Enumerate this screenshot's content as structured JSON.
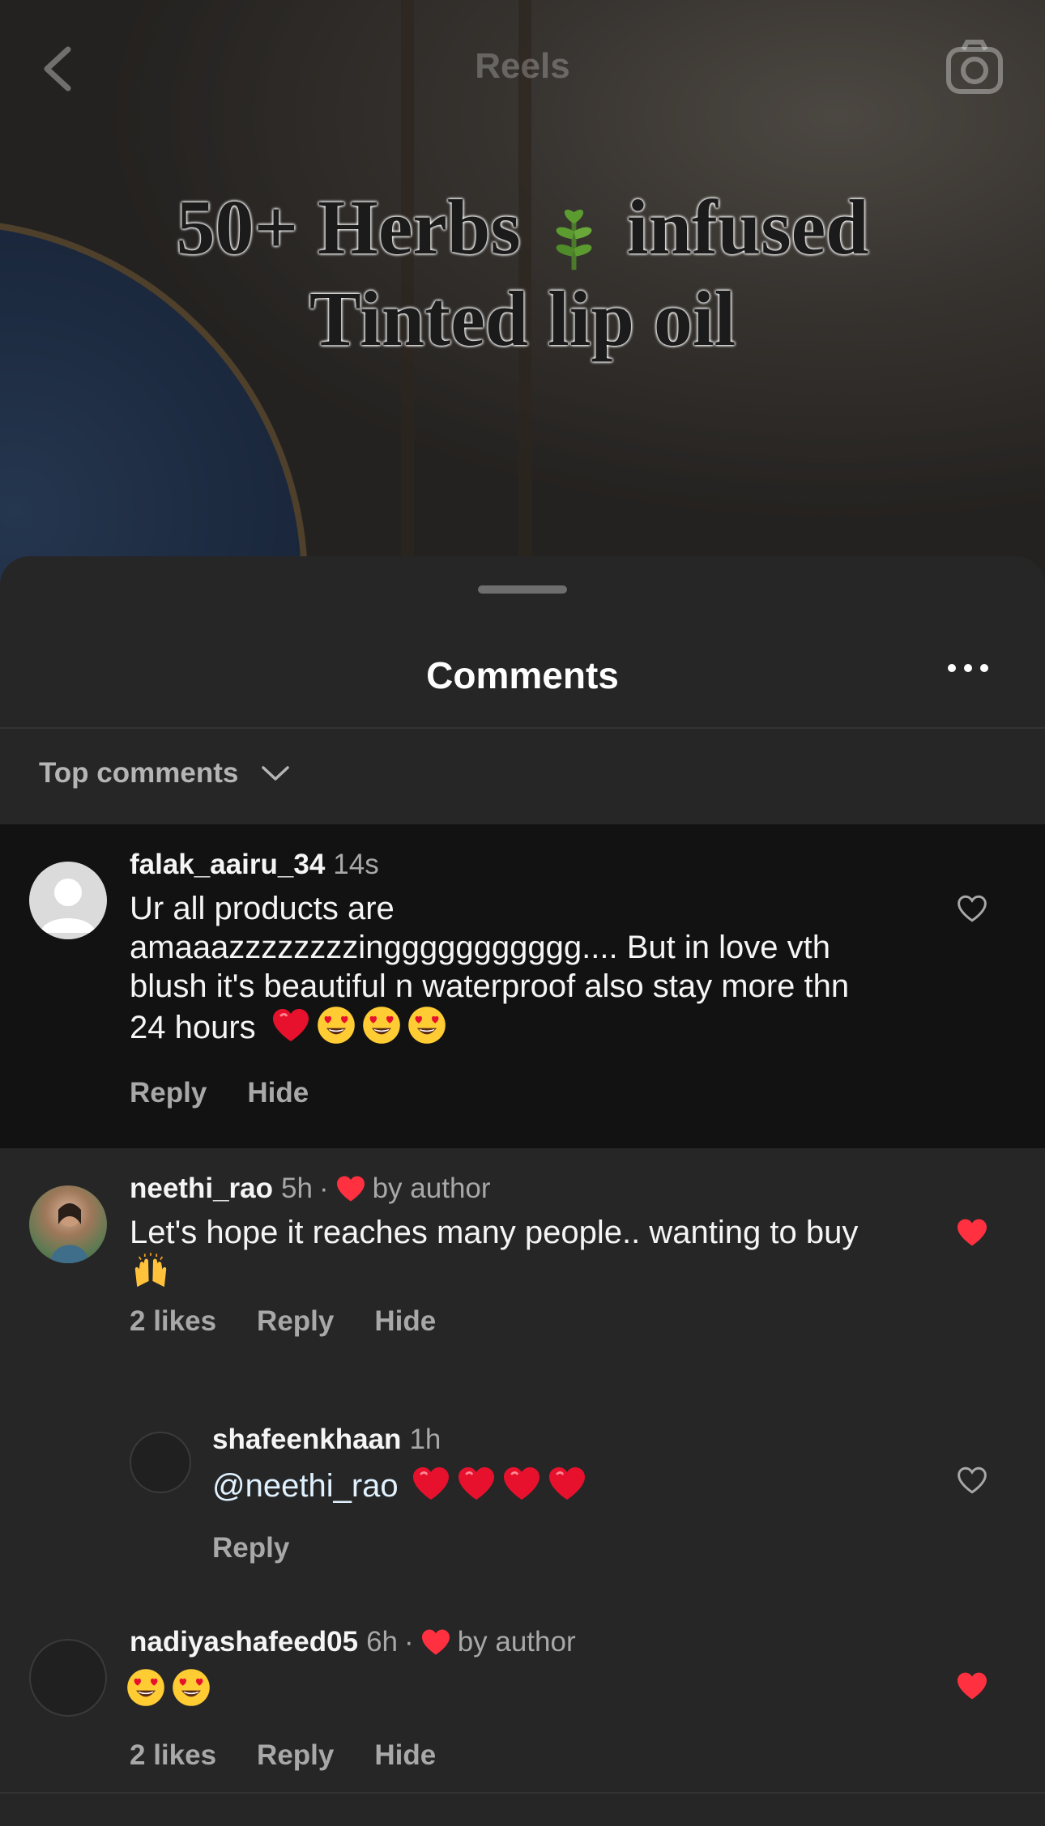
{
  "header": {
    "title": "Reels",
    "back_icon": "chevron-left-icon",
    "camera_icon": "camera-icon"
  },
  "reel_overlay": {
    "line1_left": "50+ Herbs",
    "line1_right": "infused",
    "line2": "Tinted lip oil",
    "emoji": "herb-leaf-emoji"
  },
  "comments_sheet": {
    "title": "Comments",
    "more_icon": "more-horizontal-icon",
    "sort_label": "Top comments"
  },
  "colors": {
    "like_red": "#ff3040",
    "sheet_bg": "#262626",
    "highlight_bg": "#121212",
    "muted_text": "#a8a8a8"
  },
  "comments": [
    {
      "username": "falak_aairu_34",
      "time": "14s",
      "text": "Ur all products are amaaazzzzzzzzinggggggggggg.... But in love vth blush it's beautiful n waterproof also stay more thn 24 hours",
      "emojis": [
        "red-heart",
        "heart-eyes",
        "heart-eyes",
        "heart-eyes"
      ],
      "reply": "Reply",
      "hide": "Hide",
      "liked": false
    },
    {
      "username": "neethi_rao",
      "time": "5h",
      "by_author": "by author",
      "text": "Let's hope it reaches many people.. wanting to buy",
      "emojis": [
        "raising-hands"
      ],
      "likes": "2 likes",
      "reply": "Reply",
      "hide": "Hide",
      "liked": true
    },
    {
      "username": "shafeenkhaan",
      "time": "1h",
      "mention": "@neethi_rao",
      "emojis": [
        "red-heart",
        "red-heart",
        "red-heart",
        "red-heart"
      ],
      "reply": "Reply",
      "liked": false
    },
    {
      "username": "nadiyashafeed05",
      "time": "6h",
      "by_author": "by author",
      "emojis": [
        "heart-eyes",
        "heart-eyes"
      ],
      "likes": "2 likes",
      "reply": "Reply",
      "hide": "Hide",
      "liked": true
    }
  ]
}
